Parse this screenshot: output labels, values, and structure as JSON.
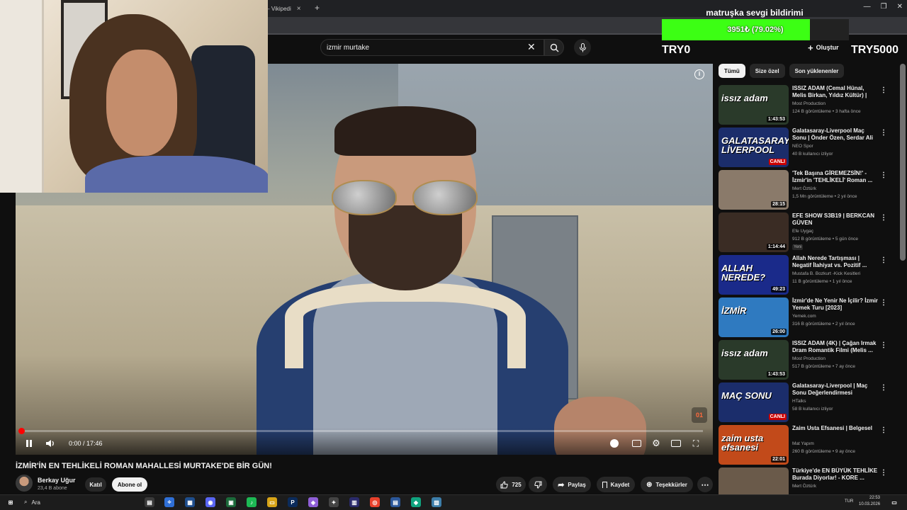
{
  "browser": {
    "tab_label": "- Vikipedi",
    "window_controls": [
      "—",
      "❐",
      "✕"
    ]
  },
  "overlay": {
    "donation_title": "matruşka sevgi bildirimi",
    "donation_text": "3951₺ (79.02%)",
    "donation_progress": 0.7902,
    "donation_color": "#3cff14",
    "try_left": "TRY0",
    "try_right": "TRY5000"
  },
  "search": {
    "value": "izmir murtake"
  },
  "header": {
    "create_label": "Oluştur"
  },
  "player": {
    "time": "0:00 / 17:46",
    "progress": 0,
    "watermark": "01"
  },
  "video": {
    "title": "İZMİR'İN EN TEHLİKELİ ROMAN MAHALLESİ MURTAKE'DE BİR GÜN!",
    "channel": "Berkay Uğur",
    "subs": "23,4 B abone",
    "join_label": "Katıl",
    "subscribe_label": "Abone ol",
    "likes": "725",
    "share_label": "Paylaş",
    "save_label": "Kaydet",
    "thanks_label": "Teşekkürler"
  },
  "sidebar": {
    "chips": [
      "Tümü",
      "Size özel",
      "Son yüklenenler"
    ],
    "items": [
      {
        "title": "ISSIZ ADAM (Cemal Hünal, Melis Birkan, Yıldız Kültür) | Fu...",
        "channel": "Most Production",
        "meta": "124 B görüntüleme • 3 hafta önce",
        "duration": "1:43:53",
        "thumb_text": "issız adam",
        "thumb_color": "#2a3a2a",
        "badge": ""
      },
      {
        "title": "Galatasaray-Liverpool Maç Sonu | Önder Özen, Serdar Ali ...",
        "channel": "NEO Spor",
        "meta": "40 B kullanıcı izliyor",
        "duration": "CANLI",
        "thumb_text": "GALATASARAY LİVERPOOL",
        "thumb_color": "#1b2d6b",
        "badge": ""
      },
      {
        "title": "'Tek Başına GİREMEZSİN!' - İzmir'in 'TEHLİKELİ' Roman ...",
        "channel": "Mert Öztürk",
        "meta": "1,5 Mn görüntüleme • 2 yıl önce",
        "duration": "28:15",
        "thumb_text": "",
        "thumb_color": "#8a7a6a",
        "badge": ""
      },
      {
        "title": "EFE SHOW S3B19 | BERKCAN GÜVEN",
        "channel": "Efe Uygaç",
        "meta": "912 B görüntüleme • 5 gün önce",
        "duration": "1:14:44",
        "thumb_text": "",
        "thumb_color": "#3a2c24",
        "badge": "Yeni"
      },
      {
        "title": "Allah Nerede Tartışması | Negatif İlahiyat vs. Pozitif ...",
        "channel": "Mustafa B. Bozkurt -Kick Kesitleri",
        "meta": "11 B görüntüleme • 1 yıl önce",
        "duration": "49:23",
        "thumb_text": "ALLAH NEREDE?",
        "thumb_color": "#1a2a8a",
        "badge": ""
      },
      {
        "title": "İzmir'de Ne Yenir Ne İçilir? İzmir Yemek Turu [2023]",
        "channel": "Yemek.com",
        "meta": "316 B görüntüleme • 2 yıl önce",
        "duration": "26:00",
        "thumb_text": "İZMİR",
        "thumb_color": "#2f7ac0",
        "badge": ""
      },
      {
        "title": "ISSIZ ADAM (4K) | Çağan Irmak Dram Romantik Filmi (Melis ...",
        "channel": "Most Production",
        "meta": "517 B görüntüleme • 7 ay önce",
        "duration": "1:43:53",
        "thumb_text": "issız adam",
        "thumb_color": "#2a3a2a",
        "badge": ""
      },
      {
        "title": "Galatasaray-Liverpool | Maç Sonu Değerlendirmesi",
        "channel": "HTalks",
        "meta": "58 B kullanıcı izliyor",
        "duration": "CANLI",
        "thumb_text": "MAÇ SONU",
        "thumb_color": "#1b2d6b",
        "badge": ""
      },
      {
        "title": "Zaim Usta Efsanesi | Belgesel",
        "channel": "Mat Yapım",
        "meta": "260 B görüntüleme • 9 ay önce",
        "duration": "22:01",
        "thumb_text": "zaim usta efsanesi",
        "thumb_color": "#c24a1a",
        "badge": ""
      },
      {
        "title": "Türkiye'de EN BÜYÜK TEHLİKE Burada Diyorlar! - KORE ...",
        "channel": "Mert Öztürk",
        "meta": "",
        "duration": "",
        "thumb_text": "",
        "thumb_color": "#6a5a4a",
        "badge": ""
      }
    ]
  },
  "taskbar": {
    "search_label": "Ara",
    "lang": "TUR",
    "time": "22:53",
    "date": "10.03.2026"
  },
  "icons": {
    "search": "search-icon",
    "mic": "mic-icon",
    "close": "close-icon",
    "play_pause": "pause-icon",
    "volume": "volume-icon",
    "like": "like-icon",
    "dislike": "dislike-icon",
    "share": "share-icon",
    "save": "save-icon",
    "thanks": "thanks-icon",
    "more": "more-icon"
  }
}
